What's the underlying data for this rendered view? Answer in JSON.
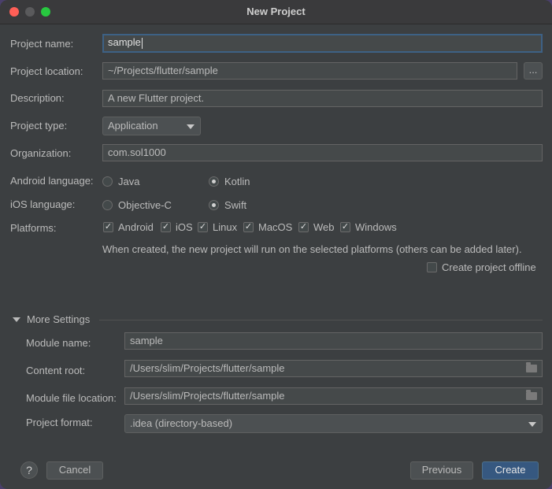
{
  "window": {
    "title": "New Project"
  },
  "project": {
    "name_label": "Project name:",
    "name_value": "sample",
    "location_label": "Project location:",
    "location_value": "~/Projects/flutter/sample",
    "browse_label": "...",
    "description_label": "Description:",
    "description_value": "A new Flutter project.",
    "type_label": "Project type:",
    "type_value": "Application",
    "organization_label": "Organization:",
    "organization_value": "com.sol1000"
  },
  "android_language": {
    "label": "Android language:",
    "options": [
      {
        "label": "Java",
        "selected": false
      },
      {
        "label": "Kotlin",
        "selected": true
      }
    ]
  },
  "ios_language": {
    "label": "iOS language:",
    "options": [
      {
        "label": "Objective-C",
        "selected": false
      },
      {
        "label": "Swift",
        "selected": true
      }
    ]
  },
  "platforms": {
    "label": "Platforms:",
    "items": [
      {
        "label": "Android",
        "checked": true
      },
      {
        "label": "iOS",
        "checked": true
      },
      {
        "label": "Linux",
        "checked": true
      },
      {
        "label": "MacOS",
        "checked": true
      },
      {
        "label": "Web",
        "checked": true
      },
      {
        "label": "Windows",
        "checked": true
      }
    ],
    "note": "When created, the new project will run on the selected platforms (others can be added later).",
    "offline_label": "Create project offline",
    "offline_checked": false
  },
  "more_settings": {
    "header": "More Settings",
    "module_name_label": "Module name:",
    "module_name_value": "sample",
    "content_root_label": "Content root:",
    "content_root_value": "/Users/slim/Projects/flutter/sample",
    "module_file_label": "Module file location:",
    "module_file_value": "/Users/slim/Projects/flutter/sample",
    "project_format_label": "Project format:",
    "project_format_value": ".idea (directory-based)"
  },
  "footer": {
    "help_label": "?",
    "cancel_label": "Cancel",
    "previous_label": "Previous",
    "create_label": "Create"
  }
}
